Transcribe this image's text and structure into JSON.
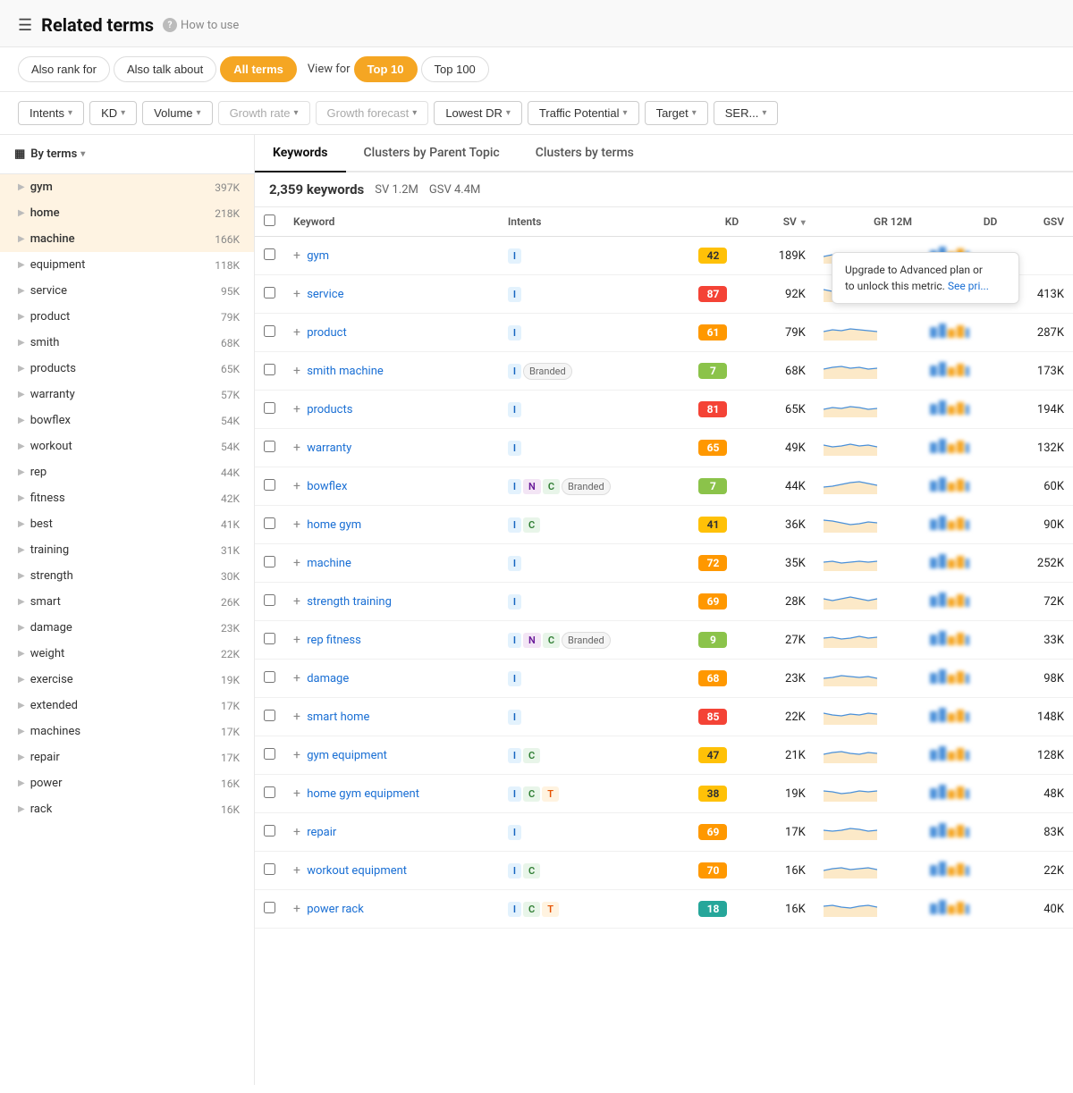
{
  "header": {
    "title": "Related terms",
    "help_text": "How to use",
    "menu_icon": "☰"
  },
  "tabs": {
    "filter_tabs": [
      {
        "id": "also-rank-for",
        "label": "Also rank for",
        "active": false
      },
      {
        "id": "also-talk-about",
        "label": "Also talk about",
        "active": false
      },
      {
        "id": "all-terms",
        "label": "All terms",
        "active": true
      }
    ],
    "view_for_label": "View for",
    "view_tabs": [
      {
        "id": "top-10",
        "label": "Top 10",
        "active": true
      },
      {
        "id": "top-100",
        "label": "Top 100",
        "active": false
      }
    ]
  },
  "filters": [
    {
      "id": "intents",
      "label": "Intents",
      "disabled": false
    },
    {
      "id": "kd",
      "label": "KD",
      "disabled": false
    },
    {
      "id": "volume",
      "label": "Volume",
      "disabled": false
    },
    {
      "id": "growth-rate",
      "label": "Growth rate",
      "disabled": true
    },
    {
      "id": "growth-forecast",
      "label": "Growth forecast",
      "disabled": true
    },
    {
      "id": "lowest-dr",
      "label": "Lowest DR",
      "disabled": false
    },
    {
      "id": "traffic-potential",
      "label": "Traffic Potential",
      "disabled": false
    },
    {
      "id": "target",
      "label": "Target",
      "disabled": false
    },
    {
      "id": "serp",
      "label": "SER...",
      "disabled": false
    }
  ],
  "sub_tabs": [
    {
      "id": "keywords",
      "label": "Keywords",
      "active": true
    },
    {
      "id": "clusters-parent",
      "label": "Clusters by Parent Topic",
      "active": false
    },
    {
      "id": "clusters-terms",
      "label": "Clusters by terms",
      "active": false
    }
  ],
  "table_info": {
    "kw_count": "2,359 keywords",
    "sv": "SV 1.2M",
    "gsv": "GSV 4.4M"
  },
  "by_terms_label": "By terms",
  "sidebar_items": [
    {
      "label": "gym",
      "count": "397K",
      "highlighted": true
    },
    {
      "label": "home",
      "count": "218K",
      "highlighted": true
    },
    {
      "label": "machine",
      "count": "166K",
      "highlighted": true
    },
    {
      "label": "equipment",
      "count": "118K",
      "highlighted": false
    },
    {
      "label": "service",
      "count": "95K",
      "highlighted": false
    },
    {
      "label": "product",
      "count": "79K",
      "highlighted": false
    },
    {
      "label": "smith",
      "count": "68K",
      "highlighted": false
    },
    {
      "label": "products",
      "count": "65K",
      "highlighted": false
    },
    {
      "label": "warranty",
      "count": "57K",
      "highlighted": false
    },
    {
      "label": "bowflex",
      "count": "54K",
      "highlighted": false
    },
    {
      "label": "workout",
      "count": "54K",
      "highlighted": false
    },
    {
      "label": "rep",
      "count": "44K",
      "highlighted": false
    },
    {
      "label": "fitness",
      "count": "42K",
      "highlighted": false
    },
    {
      "label": "best",
      "count": "41K",
      "highlighted": false
    },
    {
      "label": "training",
      "count": "31K",
      "highlighted": false
    },
    {
      "label": "strength",
      "count": "30K",
      "highlighted": false
    },
    {
      "label": "smart",
      "count": "26K",
      "highlighted": false
    },
    {
      "label": "damage",
      "count": "23K",
      "highlighted": false
    },
    {
      "label": "weight",
      "count": "22K",
      "highlighted": false
    },
    {
      "label": "exercise",
      "count": "19K",
      "highlighted": false
    },
    {
      "label": "extended",
      "count": "17K",
      "highlighted": false
    },
    {
      "label": "machines",
      "count": "17K",
      "highlighted": false
    },
    {
      "label": "repair",
      "count": "17K",
      "highlighted": false
    },
    {
      "label": "power",
      "count": "16K",
      "highlighted": false
    },
    {
      "label": "rack",
      "count": "16K",
      "highlighted": false
    }
  ],
  "table_columns": {
    "keyword": "Keyword",
    "intents": "Intents",
    "kd": "KD",
    "sv": "SV",
    "gr12m": "GR 12M",
    "dd": "DD",
    "gsv": "GSV"
  },
  "tooltip": {
    "text": "Upgrade to Advanced plan or",
    "text2": "to unlock this metric.",
    "link": "See pri..."
  },
  "keywords": [
    {
      "keyword": "gym",
      "intents": [
        {
          "type": "i",
          "label": "I"
        }
      ],
      "branded": false,
      "kd": 42,
      "kd_color": "yellow",
      "sv": "189K",
      "has_tooltip": true,
      "gsv": ""
    },
    {
      "keyword": "service",
      "intents": [
        {
          "type": "i",
          "label": "I"
        }
      ],
      "branded": false,
      "kd": 87,
      "kd_color": "red",
      "sv": "92K",
      "has_tooltip": false,
      "gsv": "413K"
    },
    {
      "keyword": "product",
      "intents": [
        {
          "type": "i",
          "label": "I"
        }
      ],
      "branded": false,
      "kd": 61,
      "kd_color": "orange",
      "sv": "79K",
      "has_tooltip": false,
      "gsv": "287K"
    },
    {
      "keyword": "smith machine",
      "intents": [
        {
          "type": "i",
          "label": "I"
        }
      ],
      "branded": true,
      "branded_label": "Branded",
      "kd": 7,
      "kd_color": "light-green",
      "sv": "68K",
      "has_tooltip": false,
      "gsv": "173K"
    },
    {
      "keyword": "products",
      "intents": [
        {
          "type": "i",
          "label": "I"
        }
      ],
      "branded": false,
      "kd": 81,
      "kd_color": "red",
      "sv": "65K",
      "has_tooltip": false,
      "gsv": "194K"
    },
    {
      "keyword": "warranty",
      "intents": [
        {
          "type": "i",
          "label": "I"
        }
      ],
      "branded": false,
      "kd": 65,
      "kd_color": "orange",
      "sv": "49K",
      "has_tooltip": false,
      "gsv": "132K"
    },
    {
      "keyword": "bowflex",
      "intents": [
        {
          "type": "i",
          "label": "I"
        },
        {
          "type": "n",
          "label": "N"
        },
        {
          "type": "c",
          "label": "C"
        }
      ],
      "branded": true,
      "branded_label": "Branded",
      "kd": 7,
      "kd_color": "light-green",
      "sv": "44K",
      "has_tooltip": false,
      "gsv": "60K"
    },
    {
      "keyword": "home gym",
      "intents": [
        {
          "type": "i",
          "label": "I"
        },
        {
          "type": "c",
          "label": "C"
        }
      ],
      "branded": false,
      "kd": 41,
      "kd_color": "yellow",
      "sv": "36K",
      "has_tooltip": false,
      "gsv": "90K"
    },
    {
      "keyword": "machine",
      "intents": [
        {
          "type": "i",
          "label": "I"
        }
      ],
      "branded": false,
      "kd": 72,
      "kd_color": "orange",
      "sv": "35K",
      "has_tooltip": false,
      "gsv": "252K"
    },
    {
      "keyword": "strength training",
      "intents": [
        {
          "type": "i",
          "label": "I"
        }
      ],
      "branded": false,
      "kd": 69,
      "kd_color": "orange",
      "sv": "28K",
      "has_tooltip": false,
      "gsv": "72K"
    },
    {
      "keyword": "rep fitness",
      "intents": [
        {
          "type": "i",
          "label": "I"
        },
        {
          "type": "n",
          "label": "N"
        },
        {
          "type": "c",
          "label": "C"
        }
      ],
      "branded": true,
      "branded_label": "Branded",
      "kd": 9,
      "kd_color": "light-green",
      "sv": "27K",
      "has_tooltip": false,
      "gsv": "33K"
    },
    {
      "keyword": "damage",
      "intents": [
        {
          "type": "i",
          "label": "I"
        }
      ],
      "branded": false,
      "kd": 68,
      "kd_color": "orange",
      "sv": "23K",
      "has_tooltip": false,
      "gsv": "98K"
    },
    {
      "keyword": "smart home",
      "intents": [
        {
          "type": "i",
          "label": "I"
        }
      ],
      "branded": false,
      "kd": 85,
      "kd_color": "red",
      "sv": "22K",
      "has_tooltip": false,
      "gsv": "148K"
    },
    {
      "keyword": "gym equipment",
      "intents": [
        {
          "type": "i",
          "label": "I"
        },
        {
          "type": "c",
          "label": "C"
        }
      ],
      "branded": false,
      "kd": 47,
      "kd_color": "yellow",
      "sv": "21K",
      "has_tooltip": false,
      "gsv": "128K"
    },
    {
      "keyword": "home gym equipment",
      "intents": [
        {
          "type": "i",
          "label": "I"
        },
        {
          "type": "c",
          "label": "C"
        },
        {
          "type": "t",
          "label": "T"
        }
      ],
      "branded": false,
      "kd": 38,
      "kd_color": "yellow",
      "sv": "19K",
      "has_tooltip": false,
      "gsv": "48K"
    },
    {
      "keyword": "repair",
      "intents": [
        {
          "type": "i",
          "label": "I"
        }
      ],
      "branded": false,
      "kd": 69,
      "kd_color": "orange",
      "sv": "17K",
      "has_tooltip": false,
      "gsv": "83K"
    },
    {
      "keyword": "workout equipment",
      "intents": [
        {
          "type": "i",
          "label": "I"
        },
        {
          "type": "c",
          "label": "C"
        }
      ],
      "branded": false,
      "kd": 70,
      "kd_color": "orange",
      "sv": "16K",
      "has_tooltip": false,
      "gsv": "22K"
    },
    {
      "keyword": "power rack",
      "intents": [
        {
          "type": "i",
          "label": "I"
        },
        {
          "type": "c",
          "label": "C"
        },
        {
          "type": "t",
          "label": "T"
        }
      ],
      "branded": false,
      "kd": 18,
      "kd_color": "teal",
      "sv": "16K",
      "has_tooltip": false,
      "gsv": "40K"
    }
  ],
  "mini_charts": {
    "colors": {
      "blue_line": "#4a90d9",
      "orange_fill": "#f5a623"
    }
  }
}
